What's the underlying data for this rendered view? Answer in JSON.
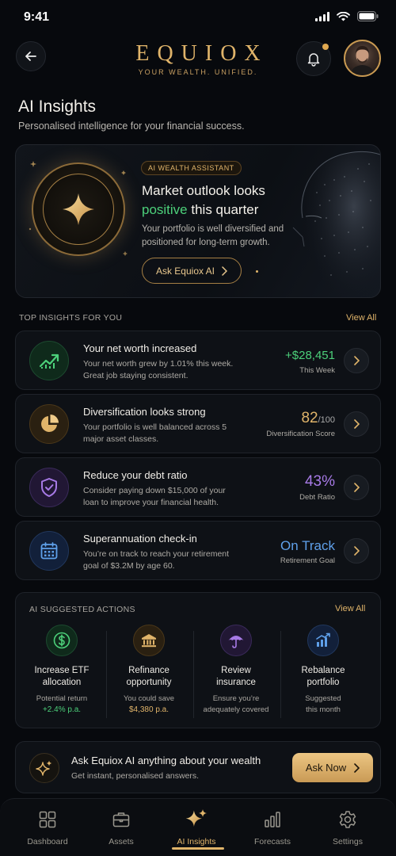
{
  "status": {
    "time": "9:41"
  },
  "header": {
    "logo": "EQUIOX",
    "tagline": "YOUR WEALTH. UNIFIED."
  },
  "page": {
    "title": "AI Insights",
    "subtitle": "Personalised intelligence for your financial success."
  },
  "hero": {
    "badge": "AI WEALTH ASSISTANT",
    "title_line1": "Market outlook looks",
    "title_highlight": "positive",
    "title_rest": " this quarter",
    "body": "Your portfolio is well diversified and positioned for long-term growth.",
    "button_label": "Ask Equiox AI"
  },
  "insights_section": {
    "label": "TOP INSIGHTS FOR YOU",
    "view_all": "View All"
  },
  "insights": [
    {
      "title": "Your net worth increased",
      "body": "Your net worth grew by 1.01% this week. Great job staying consistent.",
      "value": "+$28,451",
      "value_suffix": "",
      "caption": "This Week",
      "color": "#4cd07a"
    },
    {
      "title": "Diversification looks strong",
      "body": "Your portfolio is well balanced across 5 major asset classes.",
      "value": "82",
      "value_suffix": "/100",
      "caption": "Diversification Score",
      "color": "#e0b46a"
    },
    {
      "title": "Reduce your debt ratio",
      "body": "Consider paying down $15,000 of your loan to improve your financial health.",
      "value": "43%",
      "value_suffix": "",
      "caption": "Debt Ratio",
      "color": "#a77ae6"
    },
    {
      "title": "Superannuation check-in",
      "body": "You’re on track to reach your retirement goal of $3.2M by age 60.",
      "value": "On Track",
      "value_suffix": "",
      "caption": "Retirement Goal",
      "color": "#5fa0ea"
    }
  ],
  "actions_section": {
    "label": "AI SUGGESTED ACTIONS",
    "view_all": "View All"
  },
  "actions": [
    {
      "title_line1": "Increase ETF",
      "title_line2": "allocation",
      "caption1": "Potential return",
      "caption2": "+2.4% p.a.",
      "icon": "dollar-icon"
    },
    {
      "title_line1": "Refinance",
      "title_line2": "opportunity",
      "caption1": "You could save",
      "caption2": "$4,380 p.a.",
      "icon": "bank-icon"
    },
    {
      "title_line1": "Review",
      "title_line2": "insurance",
      "caption1": "Ensure you’re",
      "caption2": "adequately covered",
      "icon": "umbrella-icon"
    },
    {
      "title_line1": "Rebalance",
      "title_line2": "portfolio",
      "caption1": "Suggested",
      "caption2": "this month",
      "icon": "bar-chart-icon"
    }
  ],
  "askbar": {
    "title": "Ask Equiox AI anything about your wealth",
    "subtitle": "Get instant, personalised answers.",
    "button_label": "Ask Now"
  },
  "tabs": [
    {
      "label": "Dashboard",
      "icon": "grid-icon"
    },
    {
      "label": "Assets",
      "icon": "briefcase-icon"
    },
    {
      "label": "AI Insights",
      "icon": "sparkle-icon",
      "active": true
    },
    {
      "label": "Forecasts",
      "icon": "bar-chart-icon"
    },
    {
      "label": "Settings",
      "icon": "gear-icon"
    }
  ],
  "colors": {
    "accent_gold": "#e0b46a",
    "positive_green": "#4cd07a",
    "purple": "#a77ae6",
    "blue": "#5fa0ea",
    "background": "#07090d"
  }
}
